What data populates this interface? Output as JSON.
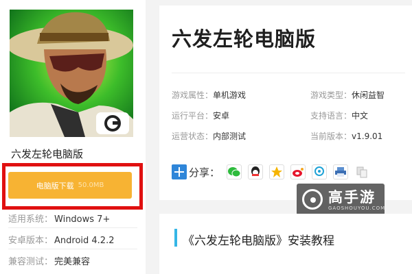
{
  "game": {
    "name": "六发左轮电脑版",
    "title": "六发左轮电脑版",
    "cover_logo_icon": "gameloft-logo-icon"
  },
  "download": {
    "label": "电脑版下载",
    "size": "50.0MB",
    "color": "#f7b333",
    "highlight_color": "#e01010"
  },
  "specs": [
    {
      "label": "适用系统：",
      "value": "Windows 7+"
    },
    {
      "label": "安卓版本：",
      "value": "Android 4.2.2"
    },
    {
      "label": "兼容测试：",
      "value": "完美兼容"
    }
  ],
  "attributes": {
    "left": [
      {
        "label": "游戏属性：",
        "value": "单机游戏"
      },
      {
        "label": "运行平台：",
        "value": "安卓"
      },
      {
        "label": "运营状态：",
        "value": "内部测试"
      }
    ],
    "right": [
      {
        "label": "游戏类型：",
        "value": "休闲益智"
      },
      {
        "label": "支持语言：",
        "value": "中文"
      },
      {
        "label": "当前版本：",
        "value": "v1.9.01"
      }
    ]
  },
  "share": {
    "label": "分享：",
    "icons": [
      "wechat-icon",
      "qq-icon",
      "qzone-icon",
      "weibo-icon",
      "tencent-weibo-icon",
      "print-icon",
      "copy-icon"
    ]
  },
  "watermark": {
    "text": "高手游",
    "sub": "GAOSHOUYOU.COM"
  },
  "guide": {
    "title": "《六发左轮电脑版》安装教程",
    "accent": "#35b6e6"
  }
}
